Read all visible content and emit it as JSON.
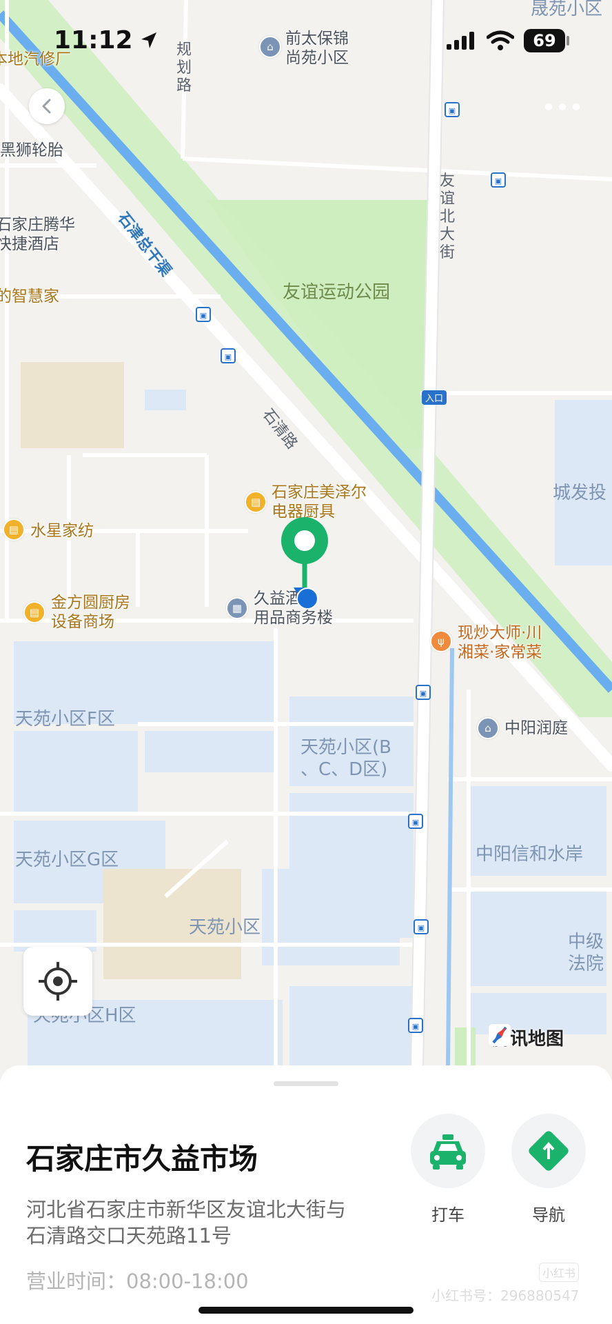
{
  "status_bar": {
    "time": "11:12",
    "battery": "69"
  },
  "map": {
    "provider": "腾讯地图",
    "roads": {
      "guihua": "规划路",
      "canal": "石津总干渠",
      "youyi": "友谊北大街",
      "shiqing": "石清路"
    },
    "entrance_badge": "入口",
    "pois": {
      "qiantai": [
        "前太保锦",
        "尚苑小区"
      ],
      "qiche": "本地汽修厂",
      "heishi": "黑狮轮胎",
      "tenghua": [
        "石家庄腾华",
        "快捷酒店"
      ],
      "zhihui": "的智慧家",
      "meizeer": [
        "石家庄美泽尔",
        "电器厨具"
      ],
      "shuixing": "水星家纺",
      "jinfang": [
        "金方圆厨房",
        "设备商场"
      ],
      "jiuyi_building": [
        "久益酒店",
        "用品商务楼"
      ],
      "xianchao": [
        "现炒大师·川",
        "湘菜·家常菜"
      ],
      "zhongyang_runting": "中阳润庭",
      "chengtou": "城发投",
      "shengyuan": "晟苑小区"
    },
    "park": "友谊运动公园",
    "areas": {
      "f": "天苑小区F区",
      "bcd": [
        "天苑小区(B",
        "、C、D区)"
      ],
      "g": "天苑小区G区",
      "main": "天苑小区",
      "h": "天苑小区H区",
      "zhongyang_xinhe": "中阳信和水岸",
      "court": [
        "中级",
        "法院"
      ]
    }
  },
  "sheet": {
    "title": "石家庄市久益市场",
    "address": [
      "河北省石家庄市新华区友谊北大街与",
      "石清路交口天苑路11号"
    ],
    "hours": "营业时间：08:00-18:00",
    "taxi_label": "打车",
    "nav_label": "导航",
    "watermark_brand": "小红书",
    "watermark_id": "小红书号：296880547"
  },
  "colors": {
    "marker_green": "#1bb26b",
    "location_blue": "#1a6fd6",
    "canal_blue": "#6aaef0",
    "park_green": "#cfeec0"
  }
}
